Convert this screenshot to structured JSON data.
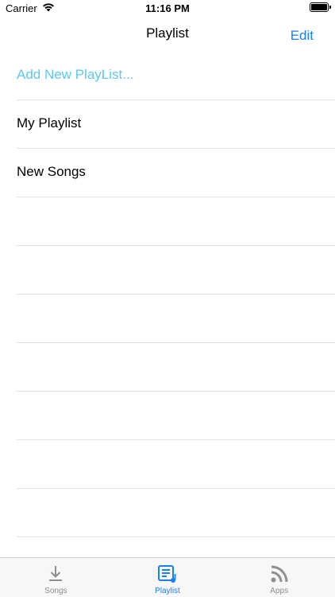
{
  "status_bar": {
    "carrier": "Carrier",
    "time": "11:16 PM"
  },
  "nav": {
    "title": "Playlist",
    "edit_label": "Edit"
  },
  "list": {
    "add_label": "Add New PlayList...",
    "items": [
      {
        "label": "My Playlist"
      },
      {
        "label": "New Songs"
      }
    ]
  },
  "tabs": [
    {
      "label": "Songs",
      "icon": "download-icon",
      "active": false
    },
    {
      "label": "Playlist",
      "icon": "playlist-icon",
      "active": true
    },
    {
      "label": "Apps",
      "icon": "rss-icon",
      "active": false
    }
  ],
  "colors": {
    "accent": "#1a7ff0",
    "add_text": "#5ac8f0",
    "inactive_tab": "#8e8e93"
  }
}
